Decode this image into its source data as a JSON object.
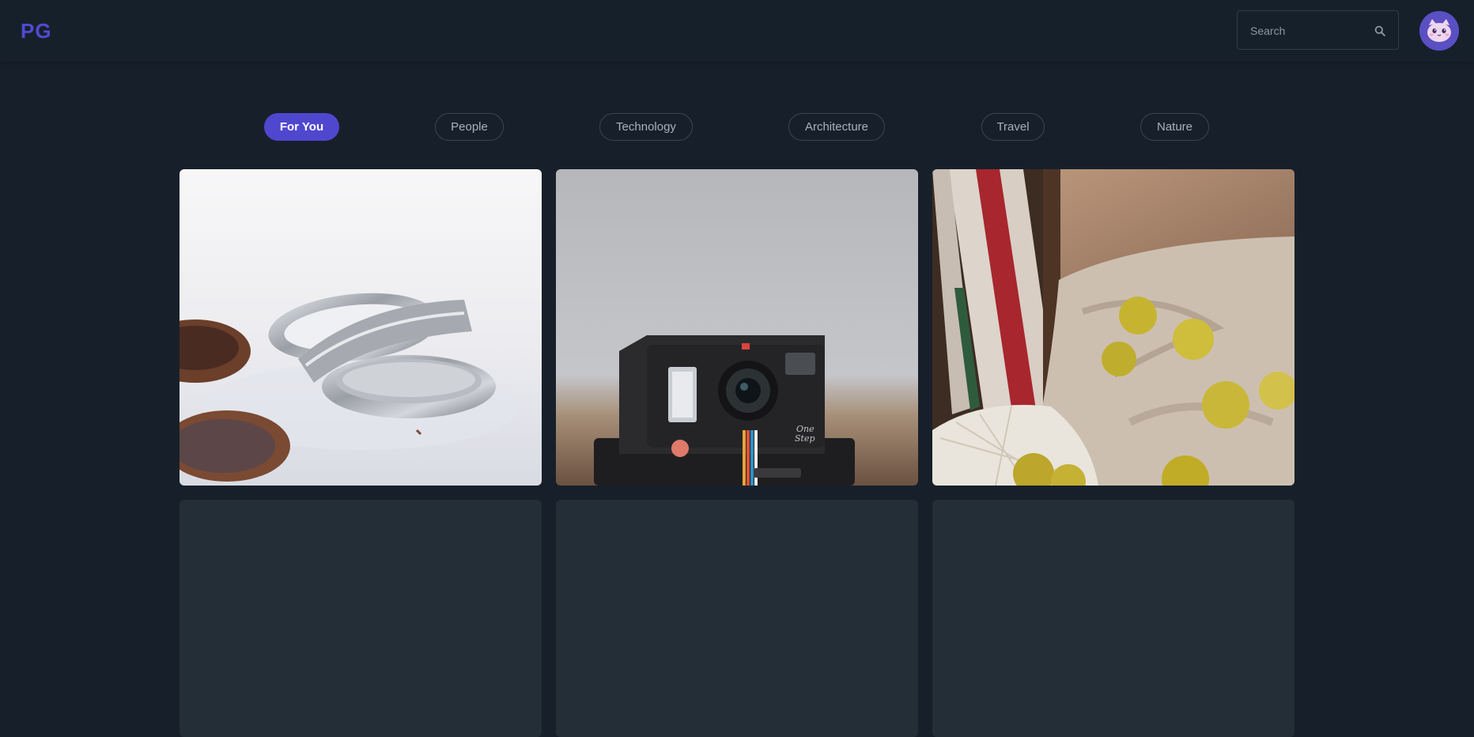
{
  "header": {
    "logo": "PG",
    "search": {
      "placeholder": "Search"
    },
    "avatar": "user-avatar"
  },
  "tabs": [
    {
      "label": "For You",
      "active": true
    },
    {
      "label": "People",
      "active": false
    },
    {
      "label": "Technology",
      "active": false
    },
    {
      "label": "Architecture",
      "active": false
    },
    {
      "label": "Travel",
      "active": false
    },
    {
      "label": "Nature",
      "active": false
    }
  ],
  "gallery": {
    "loaded": [
      "tart-tins-photo",
      "instant-camera-photo",
      "apples-on-cloth-photo"
    ],
    "placeholder_count": 3
  },
  "colors": {
    "background": "#17202a",
    "accent": "#5047cf",
    "placeholder": "#232e37"
  }
}
